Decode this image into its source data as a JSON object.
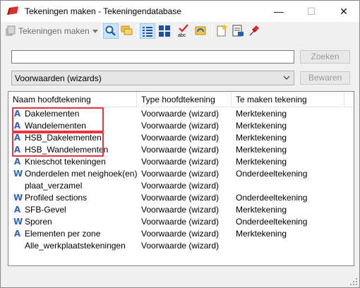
{
  "window": {
    "title": "Tekeningen maken - Tekeningendatabase"
  },
  "toolbar": {
    "dropdown_label": "Tekeningen maken"
  },
  "search": {
    "value": "",
    "button_label": "Zoeken"
  },
  "filter": {
    "selected": "Voorwaarden (wizards)",
    "save_label": "Bewaren"
  },
  "table": {
    "headers": [
      "Naam hoofdtekening",
      "Type hoofdtekening",
      "Te maken tekening"
    ],
    "rows": [
      {
        "icon": "A",
        "name": "Dakelementen",
        "type": "Voorwaarde (wizard)",
        "target": "Merktekening"
      },
      {
        "icon": "A",
        "name": "Wandelementen",
        "type": "Voorwaarde (wizard)",
        "target": "Merktekening"
      },
      {
        "icon": "A",
        "name": "HSB_Dakelementen",
        "type": "Voorwaarde (wizard)",
        "target": "Merktekening"
      },
      {
        "icon": "A",
        "name": "HSB_Wandelementen",
        "type": "Voorwaarde (wizard)",
        "target": "Merktekening"
      },
      {
        "icon": "A",
        "name": "Knieschot tekeningen",
        "type": "Voorwaarde (wizard)",
        "target": "Merktekening"
      },
      {
        "icon": "W",
        "name": "Onderdelen met neighoek(en)",
        "type": "Voorwaarde (wizard)",
        "target": "Onderdeeltekening"
      },
      {
        "icon": "",
        "name": "plaat_verzamel",
        "type": "Voorwaarde (wizard)",
        "target": ""
      },
      {
        "icon": "W",
        "name": "Profiled sections",
        "type": "Voorwaarde (wizard)",
        "target": "Onderdeeltekening"
      },
      {
        "icon": "A",
        "name": "SFB-Gevel",
        "type": "Voorwaarde (wizard)",
        "target": "Merktekening"
      },
      {
        "icon": "W",
        "name": "Sporen",
        "type": "Voorwaarde (wizard)",
        "target": "Onderdeeltekening"
      },
      {
        "icon": "A",
        "name": "Elementen per zone",
        "type": "Voorwaarde (wizard)",
        "target": "Merktekening"
      },
      {
        "icon": "",
        "name": "Alle_werkplaatstekeningen",
        "type": "Voorwaarde (wizard)",
        "target": ""
      }
    ]
  },
  "colors": {
    "highlight": "#e8353f",
    "icon_blue": "#3366b5",
    "disabled_text": "#9a9a9a"
  }
}
